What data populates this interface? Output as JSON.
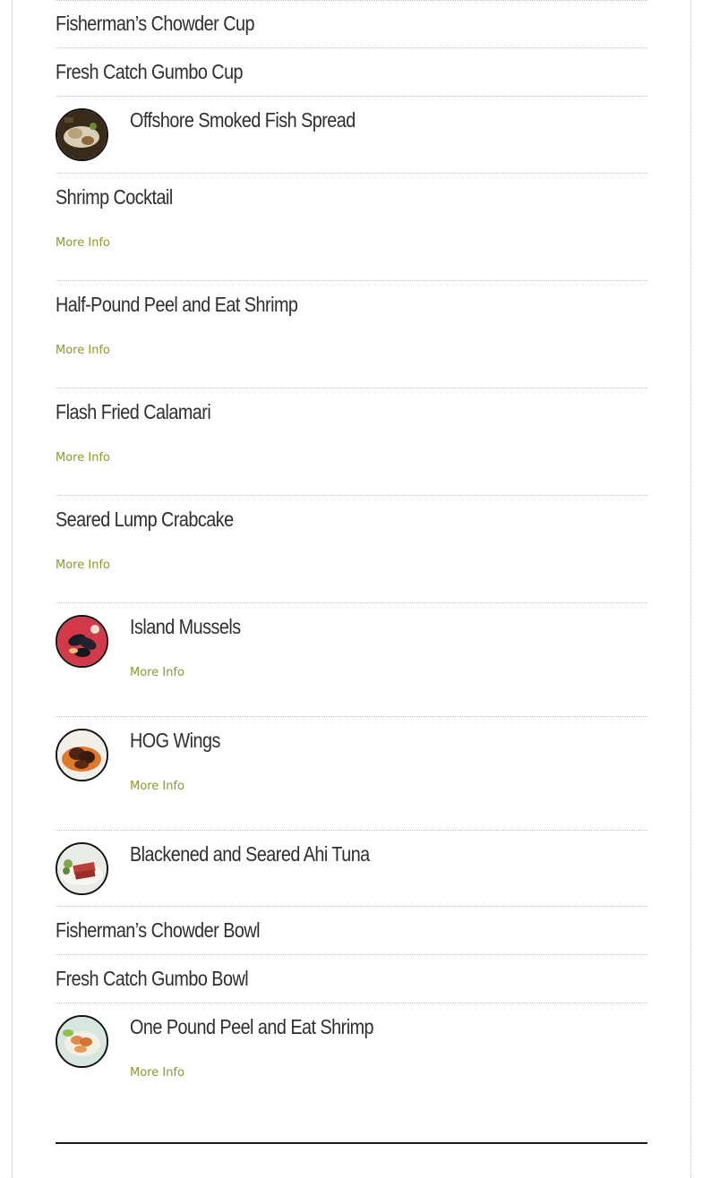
{
  "menu": {
    "more_info_label": "More Info",
    "items": [
      {
        "title": "Fisherman’s Chowder Cup"
      },
      {
        "title": "Fresh Catch Gumbo Cup"
      },
      {
        "title": "Offshore Smoked Fish Spread",
        "thumb": "smoked-fish-spread-photo"
      },
      {
        "title": "Shrimp Cocktail",
        "more_info": "More Info"
      },
      {
        "title": "Half-Pound Peel and Eat Shrimp",
        "more_info": "More Info"
      },
      {
        "title": "Flash Fried Calamari",
        "more_info": "More Info"
      },
      {
        "title": "Seared Lump Crabcake",
        "more_info": "More Info"
      },
      {
        "title": "Island Mussels",
        "thumb": "island-mussels-photo",
        "more_info": "More Info"
      },
      {
        "title": "HOG Wings",
        "thumb": "hog-wings-photo",
        "more_info": "More Info"
      },
      {
        "title": "Blackened and Seared Ahi Tuna",
        "thumb": "ahi-tuna-photo"
      },
      {
        "title": "Fisherman’s Chowder Bowl"
      },
      {
        "title": "Fresh Catch Gumbo Bowl"
      },
      {
        "title": "One Pound Peel and Eat Shrimp",
        "thumb": "peel-eat-shrimp-photo",
        "more_info": "More Info"
      }
    ]
  },
  "colors": {
    "link": "#8a9a2b",
    "title": "#2e2e2e",
    "divider": "#c6c6c6"
  }
}
